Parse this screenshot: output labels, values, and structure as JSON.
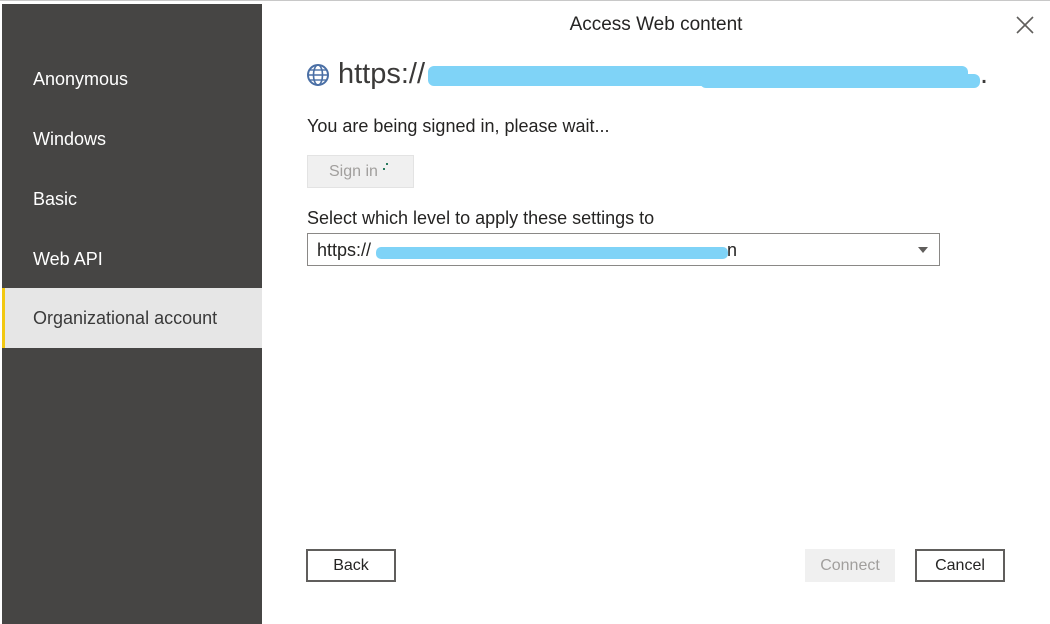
{
  "dialog": {
    "title": "Access Web content",
    "close_icon": "close-icon"
  },
  "sidebar": {
    "items": [
      {
        "label": "Anonymous",
        "selected": false
      },
      {
        "label": "Windows",
        "selected": false
      },
      {
        "label": "Basic",
        "selected": false
      },
      {
        "label": "Web API",
        "selected": false
      },
      {
        "label": "Organizational account",
        "selected": true
      }
    ],
    "background_color": "#464544",
    "selected_background_color": "#e6e6e6",
    "selected_accent_color": "#f2c811"
  },
  "resource": {
    "icon": "globe-icon",
    "url_prefix": "https://",
    "url_suffix": ".",
    "redaction_color": "#7fd3f7"
  },
  "status": {
    "message": "You are being signed in, please wait..."
  },
  "signin": {
    "label": "Sign in",
    "enabled": false
  },
  "level": {
    "label": "Select which level to apply these settings to",
    "selected_value_prefix": "https://",
    "selected_value_suffix": "n"
  },
  "footer": {
    "back_label": "Back",
    "connect_label": "Connect",
    "connect_enabled": false,
    "cancel_label": "Cancel"
  }
}
